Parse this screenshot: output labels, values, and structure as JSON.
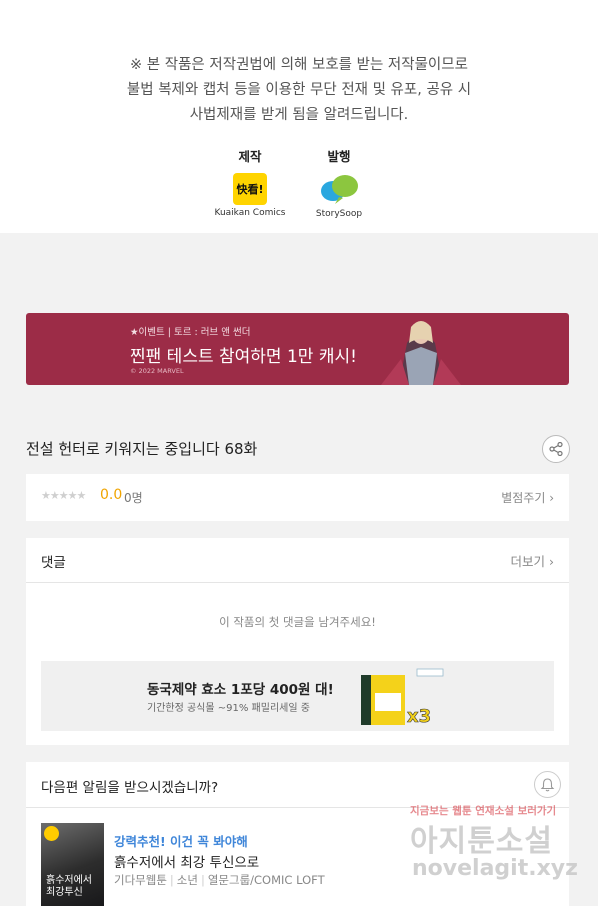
{
  "notice": {
    "line1": "※ 본 작품은 저작권법에 의해 보호를 받는 저작물이므로",
    "line2": "불법 복제와 캡처 등을 이용한 무단 전재 및 유포, 공유 시",
    "line3": "사법제재를 받게 됨을 알려드립니다."
  },
  "credits": {
    "production_label": "제작",
    "production_logo": "Kuaikan Comics",
    "production_logo_mark": "快看!",
    "publisher_label": "발행",
    "publisher_logo": "StorySoop"
  },
  "banner": {
    "small": "★이벤트 | 토르 : 러브 앤 썬더",
    "big": "찐팬 테스트 참여하면 1만 캐시!",
    "copyright": "© 2022 MARVEL"
  },
  "episode": {
    "title": "전설 헌터로 키워지는 중입니다 68화"
  },
  "rating": {
    "stars": "★★★★★",
    "score": "0.0",
    "count": "0명",
    "action": "별점주기 ›"
  },
  "comments": {
    "header": "댓글",
    "more": "더보기 ›",
    "empty": "이 작품의 첫 댓글을 남겨주세요!"
  },
  "ad": {
    "title": "동국제약 효소 1포당 400원 대!",
    "subtitle": "기간한정 공식몰 ~91% 패밀리세일 중",
    "multiplier": "x3"
  },
  "notify": {
    "question": "다음편 알림을 받으시겠습니까?"
  },
  "recommendation": {
    "tag": "강력추천! 이건 꼭 봐야해",
    "title": "흙수저에서 최강 투신으로",
    "meta": [
      "기다무웹툰",
      "소년",
      "열문그룹/COMIC LOFT"
    ],
    "thumb_title": "흙수저에서 최강투신"
  },
  "watermark": {
    "line1": "지금보는 웹툰 연재소설 보러가기",
    "line2": "아지툰소설",
    "line3": "novelagit.xyz"
  },
  "colors": {
    "banner": "#9c2c47",
    "score": "#f0a400",
    "recommend": "#3f86d9",
    "kuaikan": "#ffd400"
  }
}
